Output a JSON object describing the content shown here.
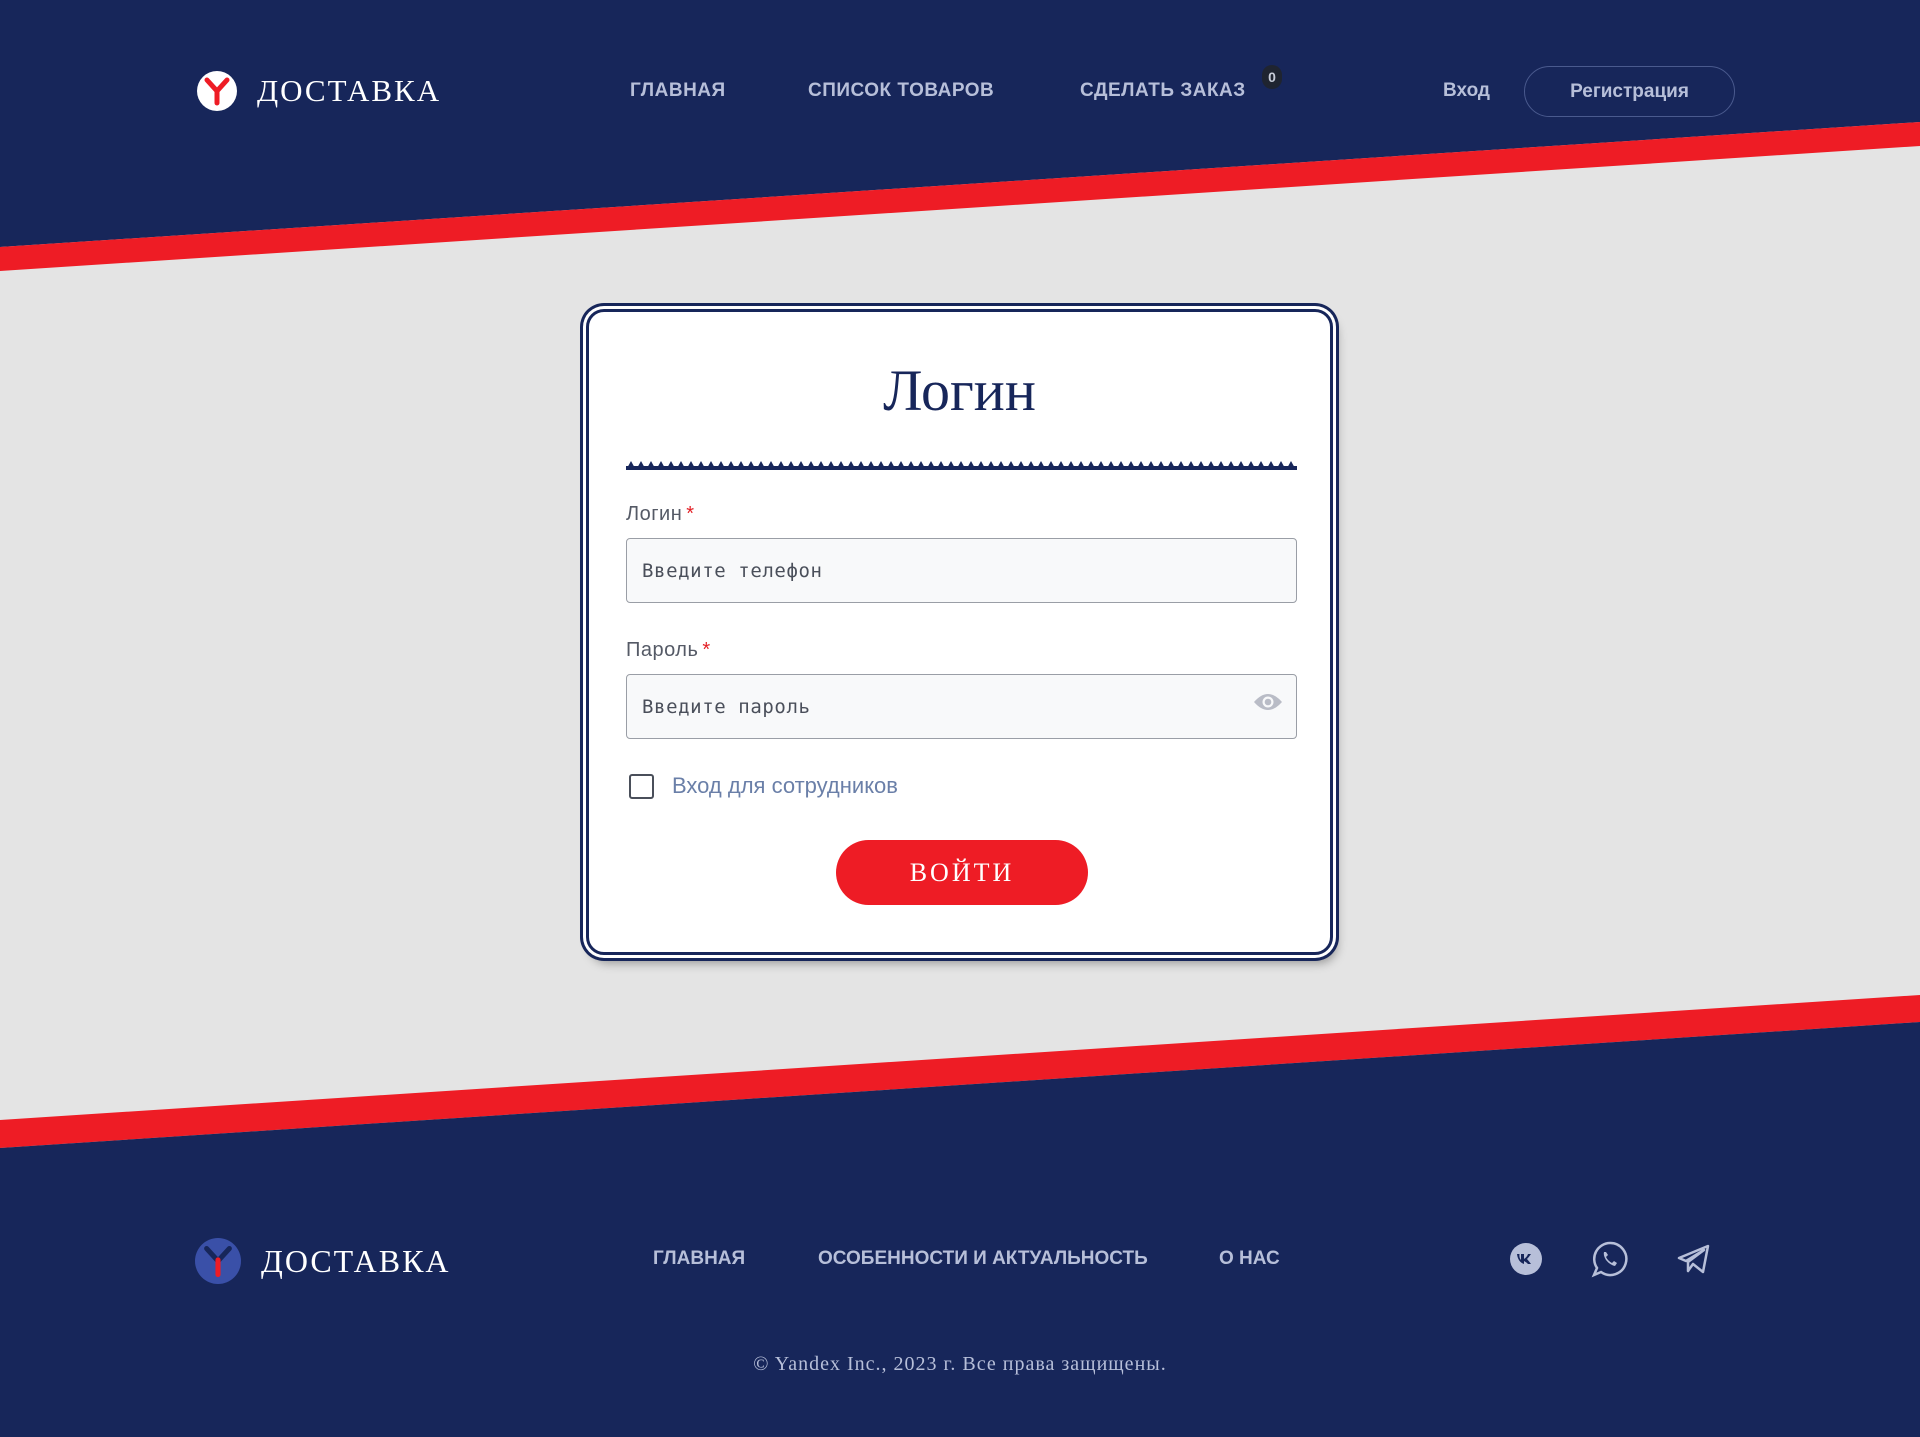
{
  "header": {
    "logo_text": "ДОСТАВКА",
    "nav": [
      {
        "label": "ГЛАВНАЯ"
      },
      {
        "label": "СПИСОК ТОВАРОВ"
      },
      {
        "label": "СДЕЛАТЬ ЗАКАЗ"
      }
    ],
    "cart_count": "0",
    "login_label": "Вход",
    "register_label": "Регистрация"
  },
  "form": {
    "title": "Логин",
    "login_label": "Логин",
    "login_placeholder": "Введите телефон",
    "password_label": "Пароль",
    "password_placeholder": "Введите пароль",
    "required_mark": "*",
    "staff_checkbox_label": "Вход для сотрудников",
    "staff_checked": false,
    "submit_label": "ВОЙТИ"
  },
  "footer": {
    "logo_text": "ДОСТАВКА",
    "nav": [
      {
        "label": "ГЛАВНАЯ"
      },
      {
        "label": "ОСОБЕННОСТИ И АКТУАЛЬНОСТЬ"
      },
      {
        "label": "О НАС"
      }
    ],
    "social": [
      "vk-icon",
      "whatsapp-icon",
      "telegram-icon"
    ],
    "copyright": "© Yandex Inc., 2023 г. Все права защищены."
  },
  "colors": {
    "navy": "#17265a",
    "red": "#ee1c25",
    "light_bg": "#e4e4e4",
    "nav_text": "#b7bfd9"
  }
}
